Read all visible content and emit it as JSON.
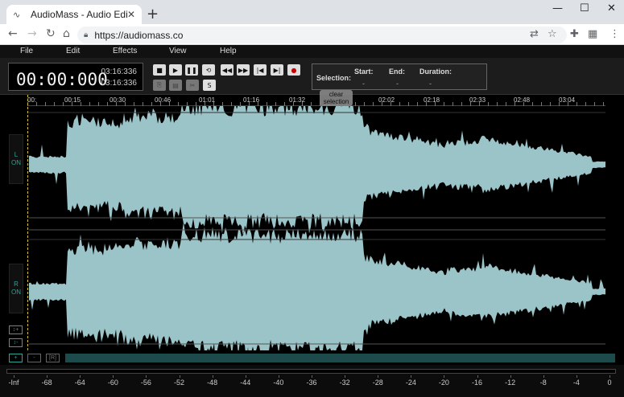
{
  "browser": {
    "tab_title": "AudioMass - Audio Editor",
    "favicon": "∿",
    "close": "✕",
    "new_tab": "+",
    "url": "https://audiomass.co",
    "window_min": "—",
    "window_max": "☐",
    "window_close": "✕"
  },
  "menu": [
    "File",
    "Edit",
    "Effects",
    "View",
    "Help"
  ],
  "time": {
    "current": "00:00:000",
    "total_a": "03:16:336",
    "total_b": "03:16:336"
  },
  "transport": {
    "shuffle_label": "S"
  },
  "selection": {
    "label": "Selection:",
    "start_label": "Start:",
    "end_label": "End:",
    "duration_label": "Duration:",
    "start_value": "-",
    "end_value": "-",
    "duration_value": "-",
    "clear_label": "clear selection"
  },
  "timeline_labels": [
    "00:",
    "00:15",
    "00:30",
    "00:46",
    "01:01",
    "01:16",
    "01:32",
    "02:02",
    "02:18",
    "02:33",
    "02:48",
    "03:04"
  ],
  "channels": {
    "left": {
      "name": "L",
      "state": "ON"
    },
    "right": {
      "name": "R",
      "state": "ON"
    }
  },
  "side_buttons": {
    "zoom_in_v": "↕+",
    "zoom_out_v": "↕-"
  },
  "bottom_buttons": {
    "zoom_in": "+",
    "zoom_out": "-",
    "reset": "[R]"
  },
  "meter_labels": [
    "-Inf",
    "-68",
    "-64",
    "-60",
    "-56",
    "-52",
    "-48",
    "-44",
    "-40",
    "-36",
    "-32",
    "-28",
    "-24",
    "-20",
    "-16",
    "-12",
    "-8",
    "-4",
    "0"
  ],
  "colors": {
    "waveform": "#9ac4c8",
    "accent": "#2aa59a",
    "playhead": "#d8c23a",
    "record": "#cc0000"
  }
}
